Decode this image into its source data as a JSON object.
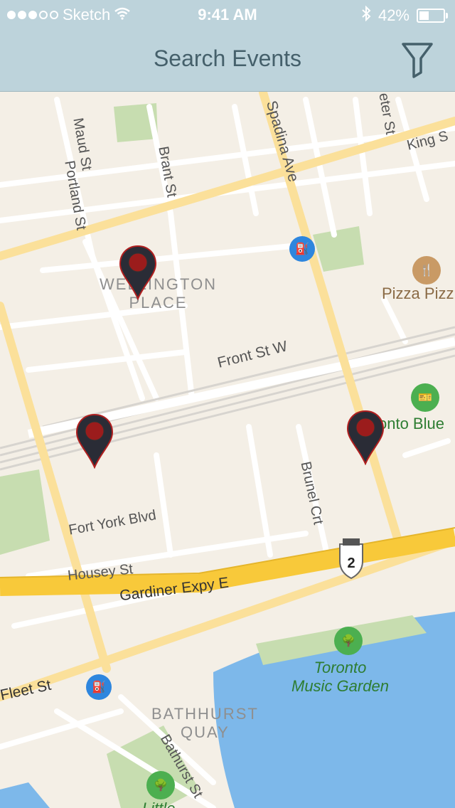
{
  "status_bar": {
    "carrier": "Sketch",
    "time": "9:41 AM",
    "battery": "42%",
    "battery_level": 0.42
  },
  "nav": {
    "title": "Search Events",
    "filter_icon": "filter-funnel-icon"
  },
  "map": {
    "streets": [
      "Maud St",
      "Brant St",
      "Portland St",
      "Spadina Ave",
      "King S",
      "Front St W",
      "Fort York Blvd",
      "Housey St",
      "Gardiner Expy E",
      "Brunel Crt",
      "Fleet St",
      "Bathurst St",
      "eter St"
    ],
    "areas": {
      "wellington": [
        "WELLINGTON",
        "PLACE"
      ],
      "bathhurst": [
        "BATHHURST",
        "QUAY"
      ],
      "music_garden": [
        "Toronto",
        "Music Garden"
      ],
      "little": "Little"
    },
    "pois": {
      "pizza": "Pizza Pizz",
      "toronto_blue": "onto Blue"
    },
    "highway_shield": "2",
    "markers": [
      "event-marker-1",
      "event-marker-2",
      "event-marker-3"
    ],
    "colors": {
      "land": "#f4efe6",
      "water": "#7db8ea",
      "park": "#c7ddb0",
      "major_road": "#fbe09a",
      "expressway": "#f8c93a",
      "marker": "#2a2c36",
      "marker_dot": "#9b1c1c",
      "gas": "#2e86de",
      "food": "#c99a65",
      "green_poi": "#4caf50"
    }
  }
}
